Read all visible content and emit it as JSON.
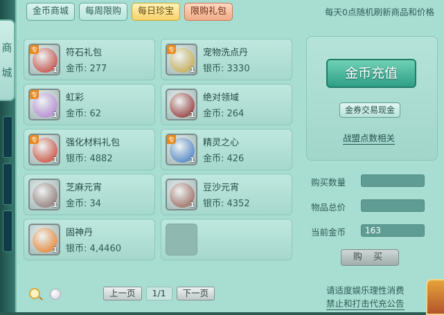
{
  "side": {
    "label_1": "商",
    "label_2": "城"
  },
  "tabs": [
    {
      "label": "金币商城"
    },
    {
      "label": "每周限购"
    },
    {
      "label": "每日珍宝"
    },
    {
      "label": "限购礼包"
    }
  ],
  "notice": "每天0点随机刷新商品和价格",
  "items": [
    {
      "name": "符石礼包",
      "price": "金币: 277",
      "qty": "1",
      "badge": "专",
      "icon": "red-gift-bag-icon",
      "color": "#c9352b"
    },
    {
      "name": "宠物洗点丹",
      "price": "银币: 3330",
      "qty": "1",
      "badge": "专",
      "icon": "gold-pills-icon",
      "color": "#c8a53a"
    },
    {
      "name": "虹彩",
      "price": "金币: 62",
      "qty": "1",
      "badge": "专",
      "icon": "rainbow-potion-icon",
      "color": "#b57bd6"
    },
    {
      "name": "绝对领域",
      "price": "金币: 264",
      "qty": "1",
      "badge": "",
      "icon": "red-dragon-icon",
      "color": "#8f1f1f"
    },
    {
      "name": "强化材料礼包",
      "price": "银币: 4882",
      "qty": "1",
      "badge": "专",
      "icon": "red-gift-bag-icon",
      "color": "#d13a26"
    },
    {
      "name": "精灵之心",
      "price": "金币: 426",
      "qty": "1",
      "badge": "专",
      "icon": "blue-spirit-heart-icon",
      "color": "#3a77c8"
    },
    {
      "name": "芝麻元宵",
      "price": "金币: 34",
      "qty": "1",
      "badge": "",
      "icon": "rice-balls-icon",
      "color": "#8a6d68"
    },
    {
      "name": "豆沙元宵",
      "price": "银币: 4352",
      "qty": "1",
      "badge": "",
      "icon": "rice-balls-icon",
      "color": "#9a5a4e"
    },
    {
      "name": "固神丹",
      "price": "银币: 4,4460",
      "qty": "1",
      "badge": "",
      "icon": "fire-orb-icon",
      "color": "#f07a1a"
    },
    {
      "name": "",
      "price": "",
      "qty": "",
      "badge": "",
      "icon": "",
      "color": "",
      "empty": true
    }
  ],
  "right": {
    "recharge_label": "金币充值",
    "exchange_label": "金券交易现金",
    "alliance_label": "战盟点数相关"
  },
  "form": {
    "qty_label": "购买数量",
    "qty_value": "",
    "total_label": "物品总价",
    "total_value": "",
    "gold_label": "当前金币",
    "gold_value": "163",
    "buy_label": "购 买"
  },
  "pager": {
    "prev": "上一页",
    "page": "1/1",
    "next": "下一页"
  },
  "footer": {
    "line1": "请适度娱乐理性消费",
    "line2": "禁止和打击代充公告"
  }
}
